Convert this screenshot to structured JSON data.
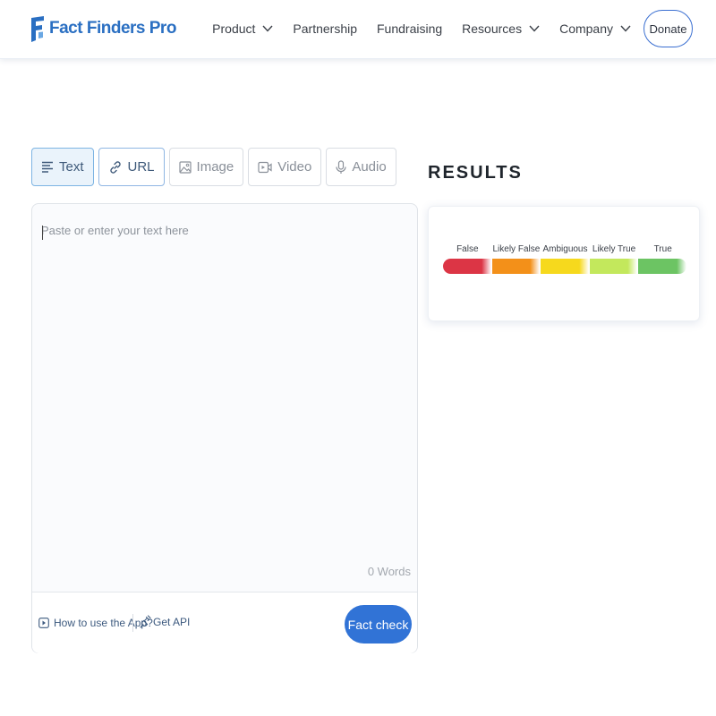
{
  "brand": {
    "name": "Fact Finders Pro",
    "color": "#2a6fc2"
  },
  "nav": {
    "items": [
      {
        "label": "Product",
        "has_dropdown": true
      },
      {
        "label": "Partnership",
        "has_dropdown": false
      },
      {
        "label": "Fundraising",
        "has_dropdown": false
      },
      {
        "label": "Resources",
        "has_dropdown": true
      },
      {
        "label": "Company",
        "has_dropdown": true
      }
    ],
    "donate_label": "Donate"
  },
  "tabs": [
    {
      "label": "Text",
      "icon": "text-lines-icon",
      "active": true
    },
    {
      "label": "URL",
      "icon": "link-icon",
      "active": false
    },
    {
      "label": "Image",
      "icon": "image-icon",
      "active": false
    },
    {
      "label": "Video",
      "icon": "video-icon",
      "active": false
    },
    {
      "label": "Audio",
      "icon": "microphone-icon",
      "active": false
    }
  ],
  "input": {
    "placeholder": "Paste or enter your text here",
    "value": "",
    "word_count": "0 Words"
  },
  "footer": {
    "how_to_label": "How to use the App?",
    "get_api_label": "Get API",
    "fact_check_label": "Fact check"
  },
  "results": {
    "title": "RESULTS",
    "scale": [
      {
        "label": "False",
        "color": "#dc3545"
      },
      {
        "label": "Likely False",
        "color": "#f39019"
      },
      {
        "label": "Ambiguous",
        "color": "#f6d91d"
      },
      {
        "label": "Likely True",
        "color": "#c3e85c"
      },
      {
        "label": "True",
        "color": "#6cc463"
      }
    ]
  },
  "colors": {
    "accent": "#3173d6",
    "active_tab_bg": "#eaf3fb"
  }
}
